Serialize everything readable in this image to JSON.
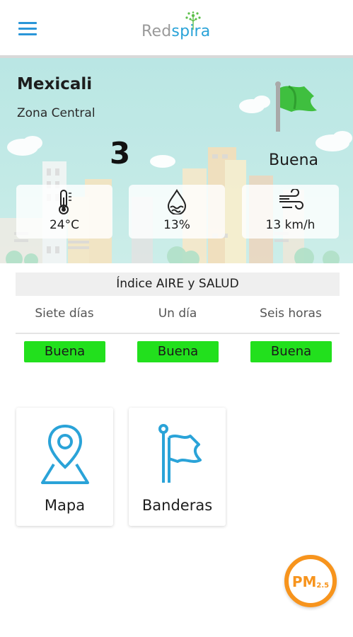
{
  "header": {
    "logo_part1": "Red",
    "logo_part2": "spira",
    "menu_icon": "hamburger-menu-icon",
    "accent": "#2a96d8"
  },
  "station": {
    "city": "Mexicali",
    "zone": "Zona Central",
    "aqi_value": "3",
    "aqi_label": "Buena"
  },
  "conditions": {
    "temperature": "24°C",
    "humidity": "13%",
    "wind": "13 km/h",
    "icons": [
      "thermometer-icon",
      "humidity-drop-icon",
      "wind-icon"
    ]
  },
  "index": {
    "title": "Índice AIRE y SALUD",
    "periods": [
      {
        "label": "Siete días",
        "status": "Buena"
      },
      {
        "label": "Un día",
        "status": "Buena"
      },
      {
        "label": "Seis horas",
        "status": "Buena"
      }
    ],
    "status_color": "#22e01d"
  },
  "tiles": [
    {
      "label": "Mapa",
      "icon": "map-pin-icon"
    },
    {
      "label": "Banderas",
      "icon": "flag-icon"
    }
  ],
  "fab": {
    "label_main": "PM",
    "label_sub": "2.5",
    "color": "#f7941d"
  }
}
